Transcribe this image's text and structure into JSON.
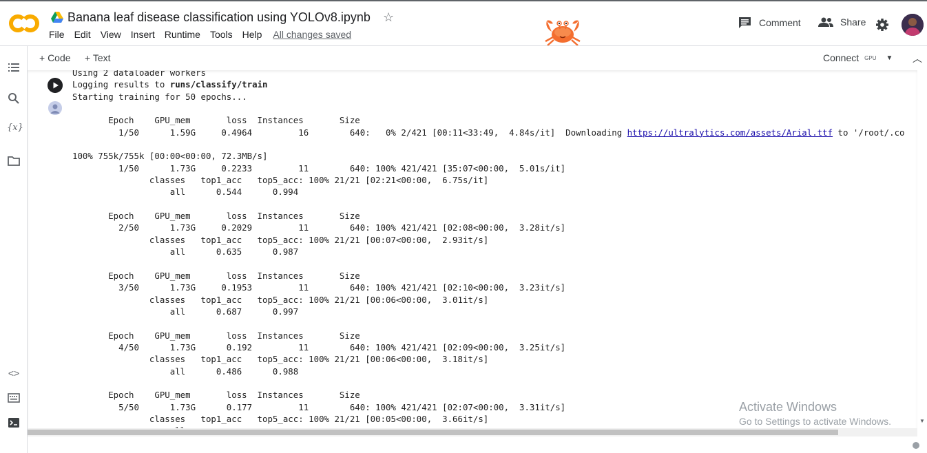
{
  "app": {
    "title": "Banana leaf disease classification using YOLOv8.ipynb",
    "saved_status": "All changes saved"
  },
  "menu": [
    "File",
    "Edit",
    "View",
    "Insert",
    "Runtime",
    "Tools",
    "Help"
  ],
  "header_actions": {
    "comment": "Comment",
    "share": "Share"
  },
  "toolbar": {
    "add_code": "+ Code",
    "add_text": "+ Text",
    "connect": "Connect",
    "runtime_type": "GPU"
  },
  "rail_icons": [
    "table-of-contents-icon",
    "search-icon",
    "variables-icon",
    "files-icon",
    "code-snippets-icon",
    "command-palette-icon",
    "terminal-icon"
  ],
  "output": {
    "intro": [
      "Using 2 dataloader workers",
      "Logging results to ",
      "runs/classify/train",
      "Starting training for 50 epochs..."
    ],
    "col_header": "       Epoch    GPU_mem       loss  Instances       Size",
    "epoch1": "         1/50      1.59G     0.4964         16        640:   0% 2/421 [00:11<33:49,  4.84s/it]  Downloading ",
    "download_url": "https://ultralytics.com/assets/Arial.ttf",
    "download_tail": " to '/root/.co",
    "dl_progress": "100% 755k/755k [00:00<00:00, 72.3MB/s]",
    "epochs": [
      {
        "train": "         1/50      1.73G     0.2233         11        640: 100% 421/421 [35:07<00:00,  5.01s/it]",
        "val_hdr": "               classes   top1_acc   top5_acc: 100% 21/21 [02:21<00:00,  6.75s/it]",
        "val": "                   all      0.544      0.994"
      },
      {
        "train": "         2/50      1.73G     0.2029         11        640: 100% 421/421 [02:08<00:00,  3.28it/s]",
        "val_hdr": "               classes   top1_acc   top5_acc: 100% 21/21 [00:07<00:00,  2.93it/s]",
        "val": "                   all      0.635      0.987"
      },
      {
        "train": "         3/50      1.73G     0.1953         11        640: 100% 421/421 [02:10<00:00,  3.23it/s]",
        "val_hdr": "               classes   top1_acc   top5_acc: 100% 21/21 [00:06<00:00,  3.01it/s]",
        "val": "                   all      0.687      0.997"
      },
      {
        "train": "         4/50      1.73G      0.192         11        640: 100% 421/421 [02:09<00:00,  3.25it/s]",
        "val_hdr": "               classes   top1_acc   top5_acc: 100% 21/21 [00:06<00:00,  3.18it/s]",
        "val": "                   all      0.486      0.988"
      },
      {
        "train": "         5/50      1.73G      0.177         11        640: 100% 421/421 [02:07<00:00,  3.31it/s]",
        "val_hdr": "               classes   top1_acc   top5_acc: 100% 21/21 [00:05<00:00,  3.66it/s]",
        "val": "                   all"
      }
    ]
  },
  "watermark": {
    "line1": "Activate Windows",
    "line2": "Go to Settings to activate Windows."
  },
  "colors": {
    "accent_orange": "#f9ab00",
    "link": "#1a0dab"
  }
}
